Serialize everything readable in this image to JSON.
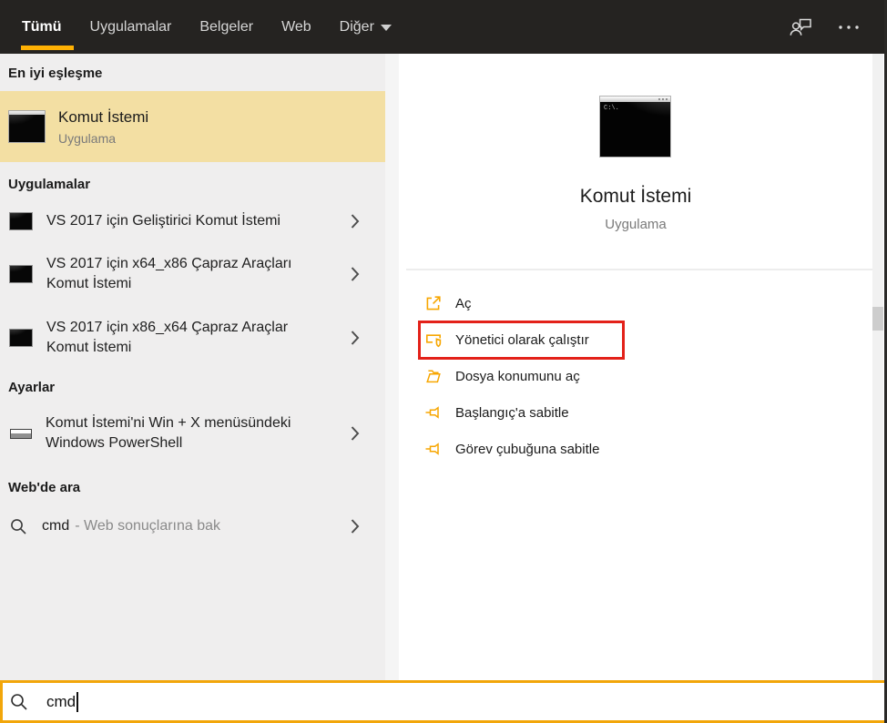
{
  "topbar": {
    "tabs": [
      "Tümü",
      "Uygulamalar",
      "Belgeler",
      "Web",
      "Diğer"
    ]
  },
  "left": {
    "best_match_header": "En iyi eşleşme",
    "best_match": {
      "title": "Komut İstemi",
      "subtitle": "Uygulama"
    },
    "apps_header": "Uygulamalar",
    "apps": [
      "VS 2017 için Geliştirici Komut İstemi",
      "VS 2017 için x64_x86 Çapraz Araçları Komut İstemi",
      "VS 2017 için x86_x64 Çapraz Araçlar Komut İstemi"
    ],
    "settings_header": "Ayarlar",
    "settings_item": "Komut İstemi'ni Win + X menüsündeki Windows PowerShell",
    "web_header": "Web'de ara",
    "web_query": "cmd",
    "web_suffix": "- Web sonuçlarına bak"
  },
  "right": {
    "app_title": "Komut İstemi",
    "app_subtitle": "Uygulama",
    "app_icon_text": "C:\\.",
    "actions": [
      "Aç",
      "Yönetici olarak çalıştır",
      "Dosya konumunu aç",
      "Başlangıç'a sabitle",
      "Görev çubuğuna sabitle"
    ]
  },
  "search": {
    "value": "cmd"
  },
  "colors": {
    "accent": "#FFB103",
    "icon_amber": "#F7A600",
    "highlight": "#F3DFA3",
    "annotation_red": "#E32119"
  }
}
